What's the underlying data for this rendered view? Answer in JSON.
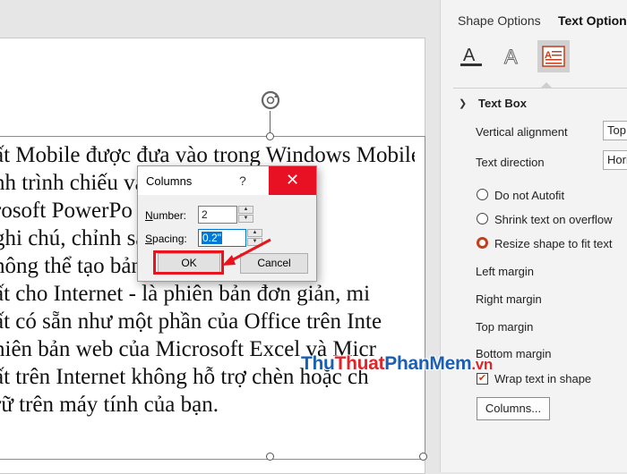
{
  "slide": {
    "lines": [
      "ất Mobile được đưa vào trong Windows Mobile",
      "nh trình chiếu                        và chỉnh sửa",
      "rosoft PowerPo                    năng của nó",
      "ghi chú, chỉnh                  sắp xếp lại",
      "hông thể tạo bản trình chiếu mới.",
      "ất cho Internet - là phiên bản đơn giản, mi",
      "ất có sẵn như một phần của Office trên Inte",
      "hiên bản web của Microsoft Excel và Micr",
      "ất trên Internet không hỗ trợ chèn hoặc ch",
      "rữ trên máy tính của bạn."
    ]
  },
  "dialog": {
    "title": "Columns",
    "help": "?",
    "close": "✕",
    "number_label_u": "N",
    "number_label_rest": "umber:",
    "number_value": "2",
    "spacing_label_u": "S",
    "spacing_label_rest": "pacing:",
    "spacing_value": "0.2\"",
    "ok_label": "OK",
    "cancel_label": "Cancel"
  },
  "pane": {
    "tab_shape_options": "Shape Options",
    "tab_text_options": "Text Options",
    "icons": [
      "text-fill-outline-icon",
      "text-effects-icon",
      "textbox-layout-icon"
    ],
    "section_title": "Text Box",
    "vertical_alignment_label": "Vertical alignment",
    "vertical_alignment_value": "Top",
    "text_direction_label": "Text direction",
    "text_direction_value": "Horizontal",
    "autofit_options": [
      {
        "label": "Do not Autofit",
        "selected": false
      },
      {
        "label": "Shrink text on overflow",
        "selected": false
      },
      {
        "label": "Resize shape to fit text",
        "selected": true
      }
    ],
    "left_margin_label": "Left margin",
    "right_margin_label": "Right margin",
    "top_margin_label": "Top margin",
    "bottom_margin_label": "Bottom margin",
    "wrap_text_label": "Wrap text in shape",
    "wrap_text_checked": true,
    "columns_button": "Columns..."
  },
  "watermark": {
    "part1": "Thu",
    "part2": "Thuat",
    "part3": "PhanMem",
    "part4": ".vn"
  },
  "colors": {
    "accent": "#c43e1c",
    "close_red": "#e81123",
    "highlight_red": "#e8141e",
    "selection_blue": "#0078d7"
  }
}
